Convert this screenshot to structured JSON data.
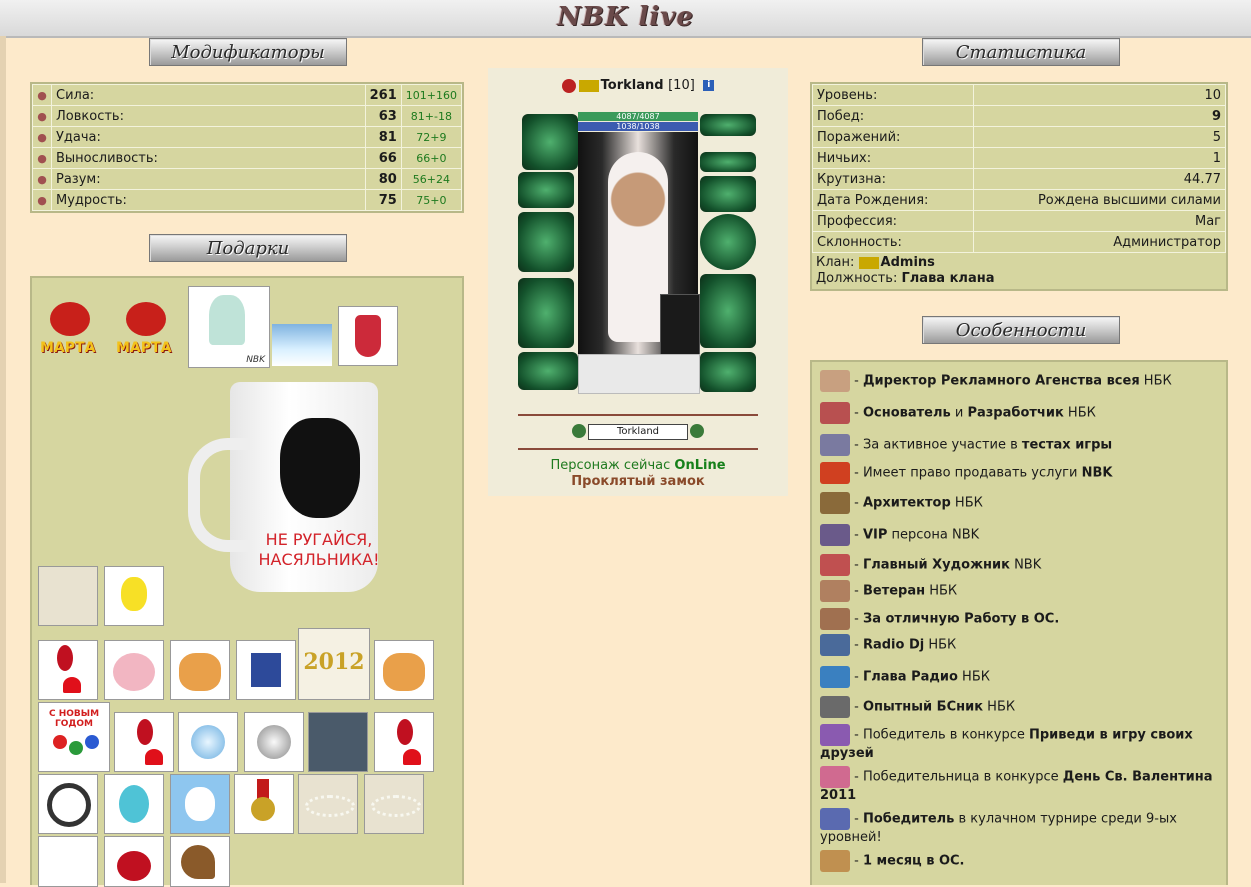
{
  "header": {
    "logo_text": "NBK live"
  },
  "modifiers": {
    "title": "Модификаторы",
    "rows": [
      {
        "icon": "horns-icon",
        "label": "Сила:",
        "value": "261",
        "bonus": "101+160"
      },
      {
        "icon": "hand-icon",
        "label": "Ловкость:",
        "value": "63",
        "bonus": "81+-18"
      },
      {
        "icon": "horseshoe-icon",
        "label": "Удача:",
        "value": "81",
        "bonus": "72+9"
      },
      {
        "icon": "torso-icon",
        "label": "Выносливость:",
        "value": "66",
        "bonus": "66+0"
      },
      {
        "icon": "crown-icon",
        "label": "Разум:",
        "value": "80",
        "bonus": "56+24"
      },
      {
        "icon": "sage-icon",
        "label": "Мудрость:",
        "value": "75",
        "bonus": "75+0"
      }
    ]
  },
  "gifts": {
    "title": "Подарки",
    "mug_text": "НЕ РУГАЙСЯ, НАСЯЛЬНИКА!",
    "march_label": "МАРТА",
    "snowdrop_label": "NBK",
    "newyear_label": "С НОВЫМ ГОДОМ",
    "year_label": "2012"
  },
  "character": {
    "name": "Torkland",
    "level": "[10]",
    "info_icon": "i",
    "hp": "4087/4087",
    "mp": "1038/1038",
    "name_field": "Torkland",
    "status_prefix": "Персонаж сейчас ",
    "status_value": "OnLine",
    "location": "Проклятый замок"
  },
  "statistics": {
    "title": "Статистика",
    "rows": [
      {
        "label": "Уровень:",
        "value": "10",
        "bold": false
      },
      {
        "label": "Побед:",
        "value": "9",
        "bold": true
      },
      {
        "label": "Поражений:",
        "value": "5",
        "bold": false
      },
      {
        "label": "Ничьих:",
        "value": "1",
        "bold": false
      },
      {
        "label": "Крутизна:",
        "value": "44.77",
        "bold": false
      },
      {
        "label": "Дата Рождения:",
        "value": "Рождена высшими силами",
        "bold": false
      },
      {
        "label": "Профессия:",
        "value": "Маг",
        "bold": false
      },
      {
        "label": "Склонность:",
        "value": "Администратор",
        "bold": false
      }
    ],
    "clan_label": "Клан:",
    "clan_name": "Admins",
    "position_label": "Должность:",
    "position_value": "Глава клана"
  },
  "features": {
    "title": "Особенности",
    "items": [
      {
        "pre": " - ",
        "b1": "Директор Рекламного Агенства всея",
        "post": " НБК"
      },
      {
        "pre": " - ",
        "b1": "Основатель",
        "mid": " и ",
        "b2": "Разработчик",
        "post": " НБК"
      },
      {
        "pre": " - За активное участие в ",
        "b1": "тестах игры",
        "post": ""
      },
      {
        "pre": " - Имеет право продавать услуги ",
        "b1": "NBK",
        "post": ""
      },
      {
        "pre": " - ",
        "b1": "Архитектор",
        "post": " НБК"
      },
      {
        "pre": " - ",
        "b1": "VIP",
        "post": " персона NBK"
      },
      {
        "pre": " - ",
        "b1": "Главный Художник",
        "post": " NBK"
      },
      {
        "pre": " - ",
        "b1": "Ветеран",
        "post": " НБК"
      },
      {
        "pre": " - ",
        "b1": "За отличную Работу в ОС.",
        "post": ""
      },
      {
        "pre": " - ",
        "b1": "Radio Dj",
        "post": " НБК"
      },
      {
        "pre": " - ",
        "b1": "Глава Радио",
        "post": " НБК"
      },
      {
        "pre": " - ",
        "b1": "Опытный БСник",
        "post": " НБК"
      },
      {
        "pre": " - Победитель в конкурсе ",
        "b1": "Приведи в игру своих друзей",
        "post": ""
      },
      {
        "pre": " - Победительница в конкурсе ",
        "b1": "День Св. Валентина 2011",
        "post": ""
      },
      {
        "pre": " - ",
        "b1": "Победитель",
        "post": " в кулачном турнире среди 9-ых уровней!"
      },
      {
        "pre": " - ",
        "b1": "1 месяц в ОС.",
        "post": ""
      }
    ]
  }
}
